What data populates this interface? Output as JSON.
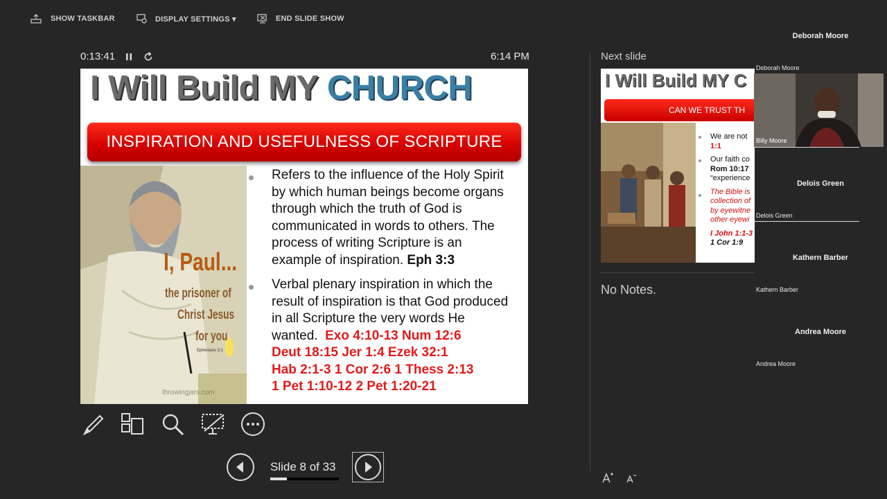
{
  "toolbar": {
    "show_taskbar": "SHOW TASKBAR",
    "display_settings": "DISPLAY SETTINGS ▾",
    "end_slide_show": "END SLIDE SHOW"
  },
  "presenter": {
    "timer": "0:13:41",
    "clock": "6:14 PM",
    "next_slide_label": "Next slide",
    "notes": "No Notes.",
    "slide_counter": "Slide 8 of 33",
    "progress": 0.2424
  },
  "current_slide": {
    "title_part1": "I Will Build MY",
    "title_part2": "CHURCH",
    "banner": "INSPIRATION AND USEFULNESS OF SCRIPTURE",
    "image_caption_line1": "I, Paul...",
    "image_caption_line2": "the prisoner of",
    "image_caption_line3": "Christ Jesus",
    "image_caption_line4": "for you",
    "image_caption_ref": "Ephesians 3:1",
    "image_watermark": "throwingjars.com",
    "bullet1_lines": [
      "Refers to the influence of the Holy Spirit",
      "by which human beings become organs",
      "through which the truth of God is",
      "communicated in words to others. The",
      "process of writing Scripture is an"
    ],
    "bullet1_last": "example of inspiration. ",
    "bullet1_ref": "Eph 3:3",
    "bullet2_lines": [
      "Verbal plenary inspiration in which the",
      "result of inspiration is that God produced",
      "in all Scripture the very words He"
    ],
    "bullet2_last": "wanted.",
    "refs_line1": "Exo 4:10-13 Num 12:6",
    "refs_line2": "Deut 18:15 Jer 1:4 Ezek 32:1",
    "refs_line3": "Hab 2:1-3 1 Cor 2:6  1 Thess 2:13",
    "refs_line4": "1 Pet 1:10-12  2 Pet 1:20-21"
  },
  "next_slide": {
    "title": "I Will Build MY C",
    "banner": "CAN WE TRUST TH",
    "line1": "We are  not",
    "line1_ref": "1:1",
    "line2": "Our faith co",
    "line2_ref": "Rom 10:17",
    "line3": "“experience",
    "red1": "The Bible is",
    "red2": "collection of",
    "red3": "by eyewitne",
    "red4": "other eyewi",
    "ref4": "I John 1:1-3",
    "ref5": "1 Cor 1:9"
  },
  "participants": [
    {
      "header": "Deborah Moore",
      "small": "Deborah Moore"
    },
    {
      "header": "",
      "small": "Billy Moore"
    },
    {
      "header": "Delois Green",
      "small": "Delois Green"
    },
    {
      "header": "Kathern Barber",
      "small": "Kathern Barber"
    },
    {
      "header": "Andrea Moore",
      "small": "Andrea Moore"
    }
  ],
  "icons": [
    "show-taskbar-icon",
    "display-settings-icon",
    "end-slide-show-icon",
    "pause-icon",
    "restart-icon",
    "pen-icon",
    "slides-grid-icon",
    "zoom-icon",
    "screen-icon",
    "more-icon",
    "previous-icon",
    "next-icon",
    "font-increase-icon",
    "font-decrease-icon"
  ],
  "colors": {
    "background": "#262626",
    "banner_red": "#d10000",
    "title_blue": "#3c7fa5",
    "ref_red": "#e21a1a"
  }
}
